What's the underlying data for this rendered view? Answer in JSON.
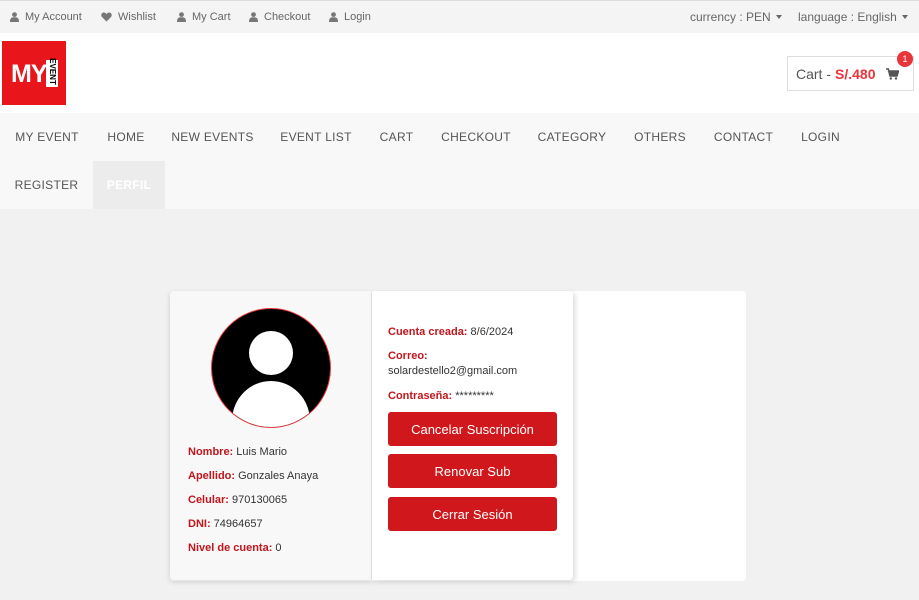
{
  "topbar": {
    "links": [
      {
        "label": "My Account",
        "icon": "user-icon"
      },
      {
        "label": "Wishlist",
        "icon": "heart-icon"
      },
      {
        "label": "My Cart",
        "icon": "user-icon"
      },
      {
        "label": "Checkout",
        "icon": "user-icon"
      },
      {
        "label": "Login",
        "icon": "user-icon"
      }
    ],
    "currency": "currency : PEN",
    "language": "language : English"
  },
  "header": {
    "logo_text": "MY",
    "logo_subtext": "EVENT",
    "cart_label": "Cart -",
    "cart_total": "S/.480",
    "cart_count": "1"
  },
  "nav": {
    "items": [
      "MY EVENT",
      "HOME",
      "NEW EVENTS",
      "EVENT LIST",
      "CART",
      "CHECKOUT",
      "CATEGORY",
      "OTHERS",
      "CONTACT",
      "LOGIN",
      "REGISTER",
      "PERFIL"
    ]
  },
  "profile": {
    "nombre_label": "Nombre:",
    "nombre": "Luis Mario",
    "apellido_label": "Apellido:",
    "apellido": "Gonzales Anaya",
    "celular_label": "Celular:",
    "celular": "970130065",
    "dni_label": "DNI:",
    "dni": "74964657",
    "nivel_label": "Nivel de cuenta:",
    "nivel": "0",
    "creada_label": "Cuenta creada:",
    "creada": "8/6/2024",
    "correo_label": "Correo:",
    "correo": "solardestello2@gmail.com",
    "contrasena_label": "Contraseña:",
    "contrasena": "*********"
  },
  "actions": {
    "cancel": "Cancelar Suscripción",
    "renew": "Renovar Sub",
    "logout": "Cerrar Sesión"
  },
  "colors": {
    "accent": "#d0171c",
    "label": "#c0161c",
    "logo": "#e8151b",
    "price": "#e8353b"
  }
}
